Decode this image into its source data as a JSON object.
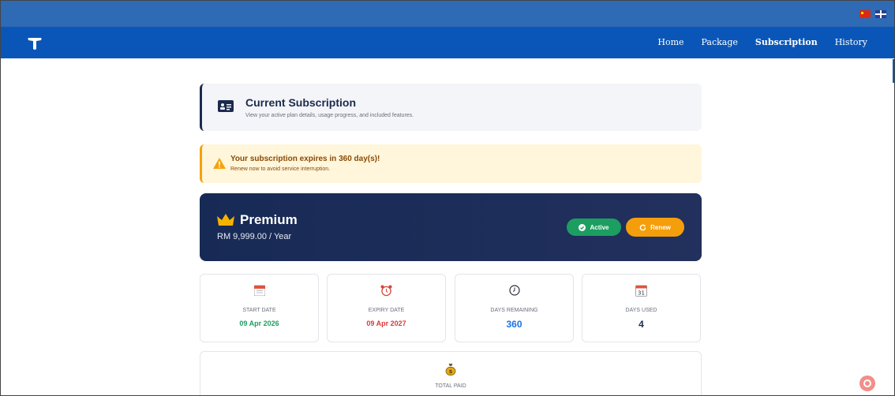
{
  "nav": {
    "items": [
      "Home",
      "Package",
      "Subscription",
      "History"
    ],
    "active": "Subscription"
  },
  "header": {
    "title": "Current Subscription",
    "subtitle": "View your active plan details, usage progress, and included features."
  },
  "alert": {
    "title": "Your subscription expires in 360 day(s)!",
    "subtitle": "Renew now to avoid service interruption."
  },
  "plan": {
    "name": "Premium",
    "price": "RM 9,999.00 / Year",
    "status_label": "Active",
    "renew_label": "Renew"
  },
  "stats": {
    "start": {
      "label": "START DATE",
      "value": "09 Apr 2026"
    },
    "expiry": {
      "label": "EXPIRY DATE",
      "value": "09 Apr 2027"
    },
    "remaining": {
      "label": "DAYS REMAINING",
      "value": "360"
    },
    "used": {
      "label": "DAYS USED",
      "value": "4"
    }
  },
  "total": {
    "label": "TOTAL PAID"
  },
  "colors": {
    "brand": "#0a56b8",
    "plan_bg": "#172a55",
    "active": "#1d9e61",
    "renew": "#f59e0b",
    "start": "#1d9e61",
    "expiry": "#d93a3a",
    "remaining": "#1a73e8",
    "used": "#1b2a4e"
  },
  "icons": {
    "logo": "t-logo-icon",
    "header": "id-card-icon",
    "alert": "warning-icon",
    "plan": "crown-icon",
    "start": "calendar-icon",
    "expiry": "alarm-clock-icon",
    "remaining": "clock-icon",
    "used": "calendar-31-icon",
    "total": "money-bag-icon",
    "chat": "chat-icon"
  }
}
